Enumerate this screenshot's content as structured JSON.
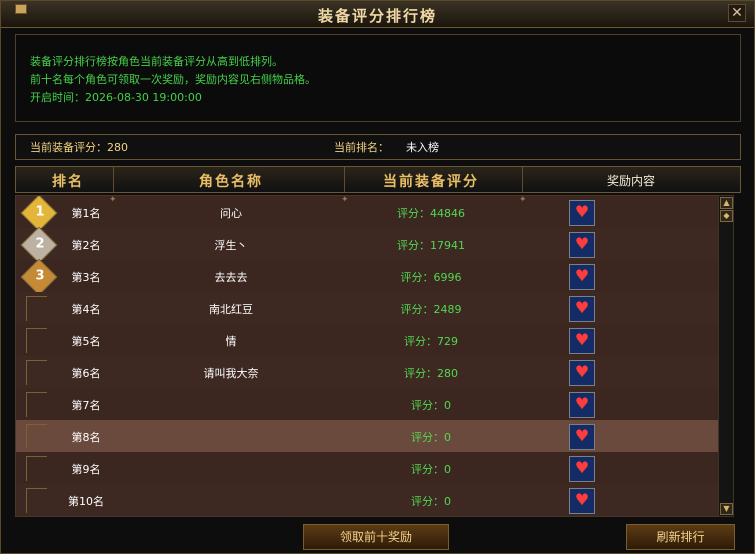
{
  "window": {
    "title": "装备评分排行榜",
    "close_glyph": "✕"
  },
  "notice": {
    "line1": "装备评分排行榜按角色当前装备评分从高到低排列。",
    "line2": "前十名每个角色可领取一次奖励，奖励内容见右侧物品格。",
    "line3": "开启时间：2026-08-30 19:00:00"
  },
  "info": {
    "score_label": "当前装备评分：280",
    "rank_label": "当前排名：",
    "rank_value": "未入榜"
  },
  "headers": {
    "rank": "排名",
    "name": "角色名称",
    "score": "当前装备评分",
    "reward": "奖励内容"
  },
  "rows": [
    {
      "rank": "第1名",
      "name": "问心",
      "score": "评分：44846",
      "medal": "1"
    },
    {
      "rank": "第2名",
      "name": "浮生丶",
      "score": "评分：17941",
      "medal": "2"
    },
    {
      "rank": "第3名",
      "name": "去去去",
      "score": "评分：6996",
      "medal": "3"
    },
    {
      "rank": "第4名",
      "name": "南北红豆",
      "score": "评分：2489"
    },
    {
      "rank": "第5名",
      "name": "情",
      "score": "评分：729"
    },
    {
      "rank": "第6名",
      "name": "请叫我大奈",
      "score": "评分：280"
    },
    {
      "rank": "第7名",
      "name": "",
      "score": "评分：0"
    },
    {
      "rank": "第8名",
      "name": "",
      "score": "评分：0"
    },
    {
      "rank": "第9名",
      "name": "",
      "score": "评分：0"
    },
    {
      "rank": "第10名",
      "name": "",
      "score": "评分：0"
    }
  ],
  "buttons": {
    "claim": "领取前十奖励",
    "refresh": "刷新排行"
  },
  "icons": {
    "reward": "gift-box-icon",
    "scroll_up": "scroll-up-icon",
    "scroll_down": "scroll-down-icon"
  },
  "colors": {
    "accent_gold": "#e8bf67",
    "score_green": "#52d752",
    "notice_green": "#43d14a",
    "selected_row": "#6b4a3e"
  }
}
